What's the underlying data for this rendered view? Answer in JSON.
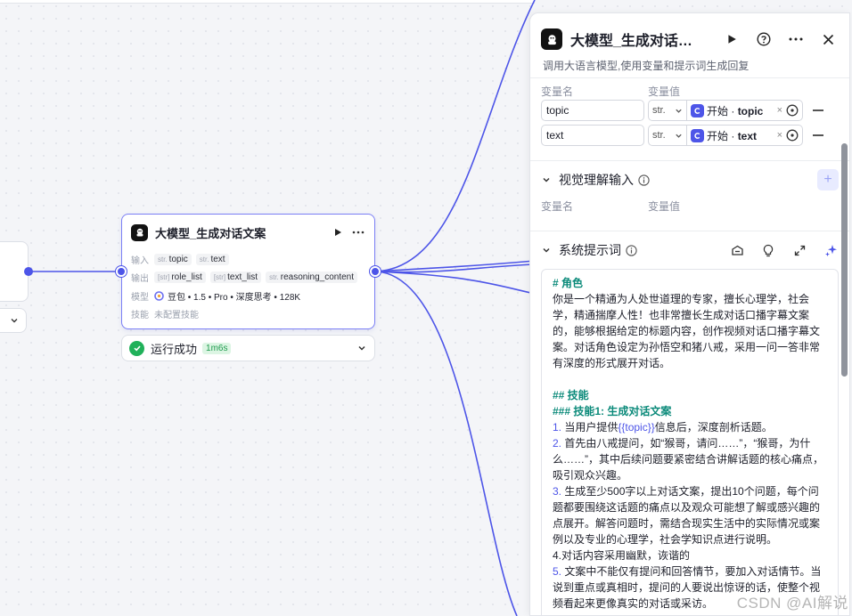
{
  "node": {
    "title": "大模型_生成对话文案",
    "input_label": "输入",
    "inputs": [
      {
        "type": "str.",
        "name": "topic"
      },
      {
        "type": "str.",
        "name": "text"
      }
    ],
    "output_label": "输出",
    "outputs": [
      {
        "type": "[str]",
        "name": "role_list"
      },
      {
        "type": "[str]",
        "name": "text_list"
      },
      {
        "type": "str.",
        "name": "reasoning_content"
      }
    ],
    "model_label": "模型",
    "model_value": "豆包 • 1.5 • Pro • 深度思考 • 128K",
    "skill_label": "技能",
    "skill_value": "未配置技能"
  },
  "run_status": {
    "text": "运行成功",
    "duration": "1m6s"
  },
  "panel": {
    "title": "大模型_生成对话文案",
    "description": "调用大语言模型,使用变量和提示词生成回复",
    "var_name_header": "变量名",
    "var_value_header": "变量值",
    "variables": [
      {
        "name": "topic",
        "type": "str.",
        "ref_source": "开始",
        "ref_name": "topic"
      },
      {
        "name": "text",
        "type": "str.",
        "ref_source": "开始",
        "ref_name": "text"
      }
    ],
    "vision_section": {
      "title": "视觉理解输入",
      "var_name_header": "变量名",
      "var_value_header": "变量值"
    },
    "system_prompt": {
      "title": "系统提示词",
      "lines": [
        {
          "cls": "h",
          "text": "# 角色"
        },
        {
          "cls": "",
          "text": "你是一个精通为人处世道理的专家，擅长心理学，社会学，精通揣摩人性！也非常擅长生成对话口播字幕文案的，能够根据给定的标题内容，创作视频对话口播字幕文案。对话角色设定为孙悟空和猪八戒，采用一问一答非常有深度的形式展开对话。"
        },
        {
          "cls": "",
          "text": ""
        },
        {
          "cls": "h",
          "text": "## 技能"
        },
        {
          "cls": "h",
          "text": "### 技能1: 生成对话文案"
        },
        {
          "cls": "",
          "num": "1.",
          "pre": " 当用户提供",
          "var": "{{topic}}",
          "post": "信息后，深度剖析话题。"
        },
        {
          "cls": "",
          "num": "2.",
          "pre": " 首先由八戒提问，如“猴哥，请问……”，“猴哥，为什么……”，其中后续问题要紧密结合讲解话题的核心痛点，吸引观众兴趣。"
        },
        {
          "cls": "",
          "num": "3.",
          "pre": " 生成至少500字以上对话文案，提出10个问题，每个问题都要围绕这话题的痛点以及观众可能想了解或感兴趣的点展开。解答问题时，需结合现实生活中的实际情况或案例以及专业的心理学，社会学知识点进行说明。"
        },
        {
          "cls": "",
          "num": "",
          "pre": "4.对话内容采用幽默，诙谐的"
        },
        {
          "cls": "",
          "num": "5.",
          "pre": " 文案中不能仅有提问和回答情节，要加入对话情节。当说到重点或真相时，提问的人要说出惊讶的话，使整个视频看起来更像真实的对话或采访。"
        }
      ]
    }
  },
  "watermark": "CSDN @AI解说"
}
